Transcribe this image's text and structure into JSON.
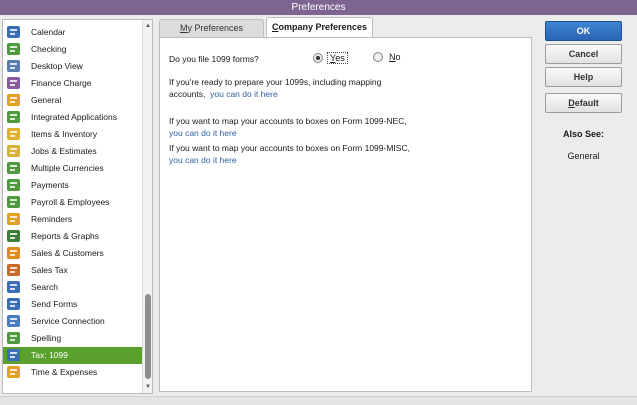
{
  "window": {
    "title": "Preferences"
  },
  "sidebar": {
    "items": [
      {
        "label": "Calendar",
        "icon": "calendar-icon",
        "color": "#3a6fb8"
      },
      {
        "label": "Checking",
        "icon": "checking-icon",
        "color": "#4f9a3e"
      },
      {
        "label": "Desktop View",
        "icon": "desktop-view-icon",
        "color": "#5a7bb0"
      },
      {
        "label": "Finance Charge",
        "icon": "finance-charge-icon",
        "color": "#8a5c9e"
      },
      {
        "label": "General",
        "icon": "general-icon",
        "color": "#e0a21f"
      },
      {
        "label": "Integrated Applications",
        "icon": "integrated-apps-icon",
        "color": "#4f9a3e"
      },
      {
        "label": "Items & Inventory",
        "icon": "items-inventory-icon",
        "color": "#e0b12a"
      },
      {
        "label": "Jobs & Estimates",
        "icon": "jobs-estimates-icon",
        "color": "#d8b23a"
      },
      {
        "label": "Multiple Currencies",
        "icon": "multiple-currencies-icon",
        "color": "#4f9a3e"
      },
      {
        "label": "Payments",
        "icon": "payments-icon",
        "color": "#4f9a3e"
      },
      {
        "label": "Payroll & Employees",
        "icon": "payroll-employees-icon",
        "color": "#4f9a3e"
      },
      {
        "label": "Reminders",
        "icon": "reminders-icon",
        "color": "#e0a21f"
      },
      {
        "label": "Reports & Graphs",
        "icon": "reports-graphs-icon",
        "color": "#3d7d3a"
      },
      {
        "label": "Sales & Customers",
        "icon": "sales-customers-icon",
        "color": "#e08a1f"
      },
      {
        "label": "Sales Tax",
        "icon": "sales-tax-icon",
        "color": "#c96a2a"
      },
      {
        "label": "Search",
        "icon": "search-icon",
        "color": "#3a6fb8"
      },
      {
        "label": "Send Forms",
        "icon": "send-forms-icon",
        "color": "#3a6fb8"
      },
      {
        "label": "Service Connection",
        "icon": "service-connection-icon",
        "color": "#4a7dbf"
      },
      {
        "label": "Spelling",
        "icon": "spelling-icon",
        "color": "#4f9a3e"
      },
      {
        "label": "Tax: 1099",
        "icon": "tax-1099-icon",
        "color": "#3a6fb8",
        "selected": true
      },
      {
        "label": "Time & Expenses",
        "icon": "time-expenses-icon",
        "color": "#e0a21f"
      }
    ]
  },
  "tabs": [
    {
      "label": "My Preferences",
      "mnemonic": "M",
      "rest": "y Preferences",
      "active": false
    },
    {
      "label": "Company Preferences",
      "mnemonic": "C",
      "rest": "ompany Preferences",
      "active": true
    }
  ],
  "company_prefs": {
    "question": "Do you file 1099 forms?",
    "options": [
      {
        "label": "Yes",
        "mnemonic": "Y",
        "rest": "es",
        "checked": true
      },
      {
        "label": "No",
        "mnemonic": "N",
        "rest": "o",
        "checked": false
      }
    ],
    "prepare_text_1": "If you're ready to prepare your 1099s, including mapping",
    "prepare_text_2": "accounts,",
    "prepare_link": "you can do it here",
    "nec_text": "If you want to map your accounts to boxes on Form 1099-NEC,",
    "nec_link": "you can do it here",
    "misc_text": "If you want to map your accounts to boxes on Form 1099-MISC,",
    "misc_link": "you can do it here"
  },
  "buttons": {
    "ok": "OK",
    "cancel": "Cancel",
    "help": "Help",
    "default_label": "Default",
    "default_mnemonic": "D",
    "default_rest": "efault"
  },
  "also_see": {
    "heading": "Also See:",
    "items": [
      "General"
    ]
  },
  "colors": {
    "title_bar": "#7c6590",
    "selection": "#5aa02c",
    "link": "#2d5fa0",
    "ok_button": "#2a64b5"
  }
}
